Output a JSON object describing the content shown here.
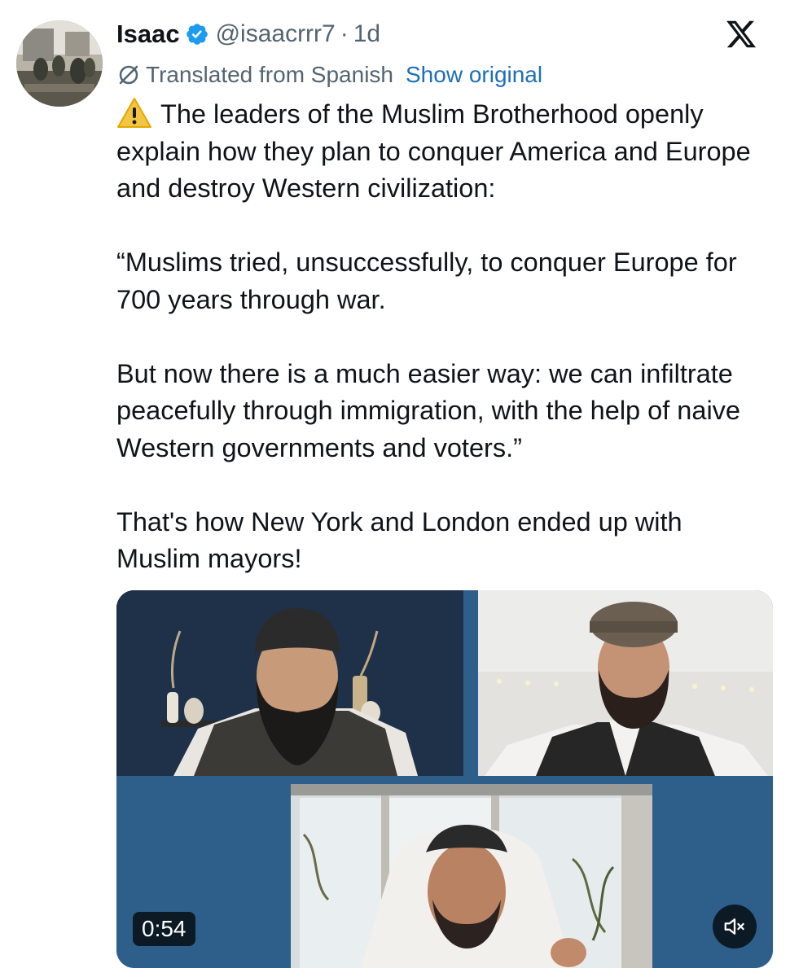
{
  "author": {
    "display_name": "Isaac",
    "handle": "@isaacrrr7",
    "separator": "·",
    "time": "1d",
    "verified": true
  },
  "translation": {
    "label": "Translated from Spanish",
    "action": "Show original"
  },
  "tweet": {
    "warning_icon": "⚠️",
    "paragraphs": [
      "The leaders of the Muslim Brotherhood openly explain how they plan to conquer America and Europe and destroy Western civilization:",
      "“Muslims tried, unsuccessfully, to conquer Europe for 700 years through war.",
      "But now there is a much easier way: we can infiltrate peacefully through immigration, with the help of naive Western governments and voters.”",
      "That's how New York and London ended up with Muslim mayors!"
    ]
  },
  "media": {
    "duration": "0:54",
    "muted": true
  },
  "icons": {
    "verified": "verified-badge-icon",
    "translate": "globe-off-icon",
    "logo": "x-logo-icon",
    "mute": "speaker-muted-icon"
  },
  "colors": {
    "text": "#0f1419",
    "secondary": "#536471",
    "link": "#1d6fb8",
    "verified": "#1d9bf0",
    "media_frame": "#2d5f8a"
  }
}
